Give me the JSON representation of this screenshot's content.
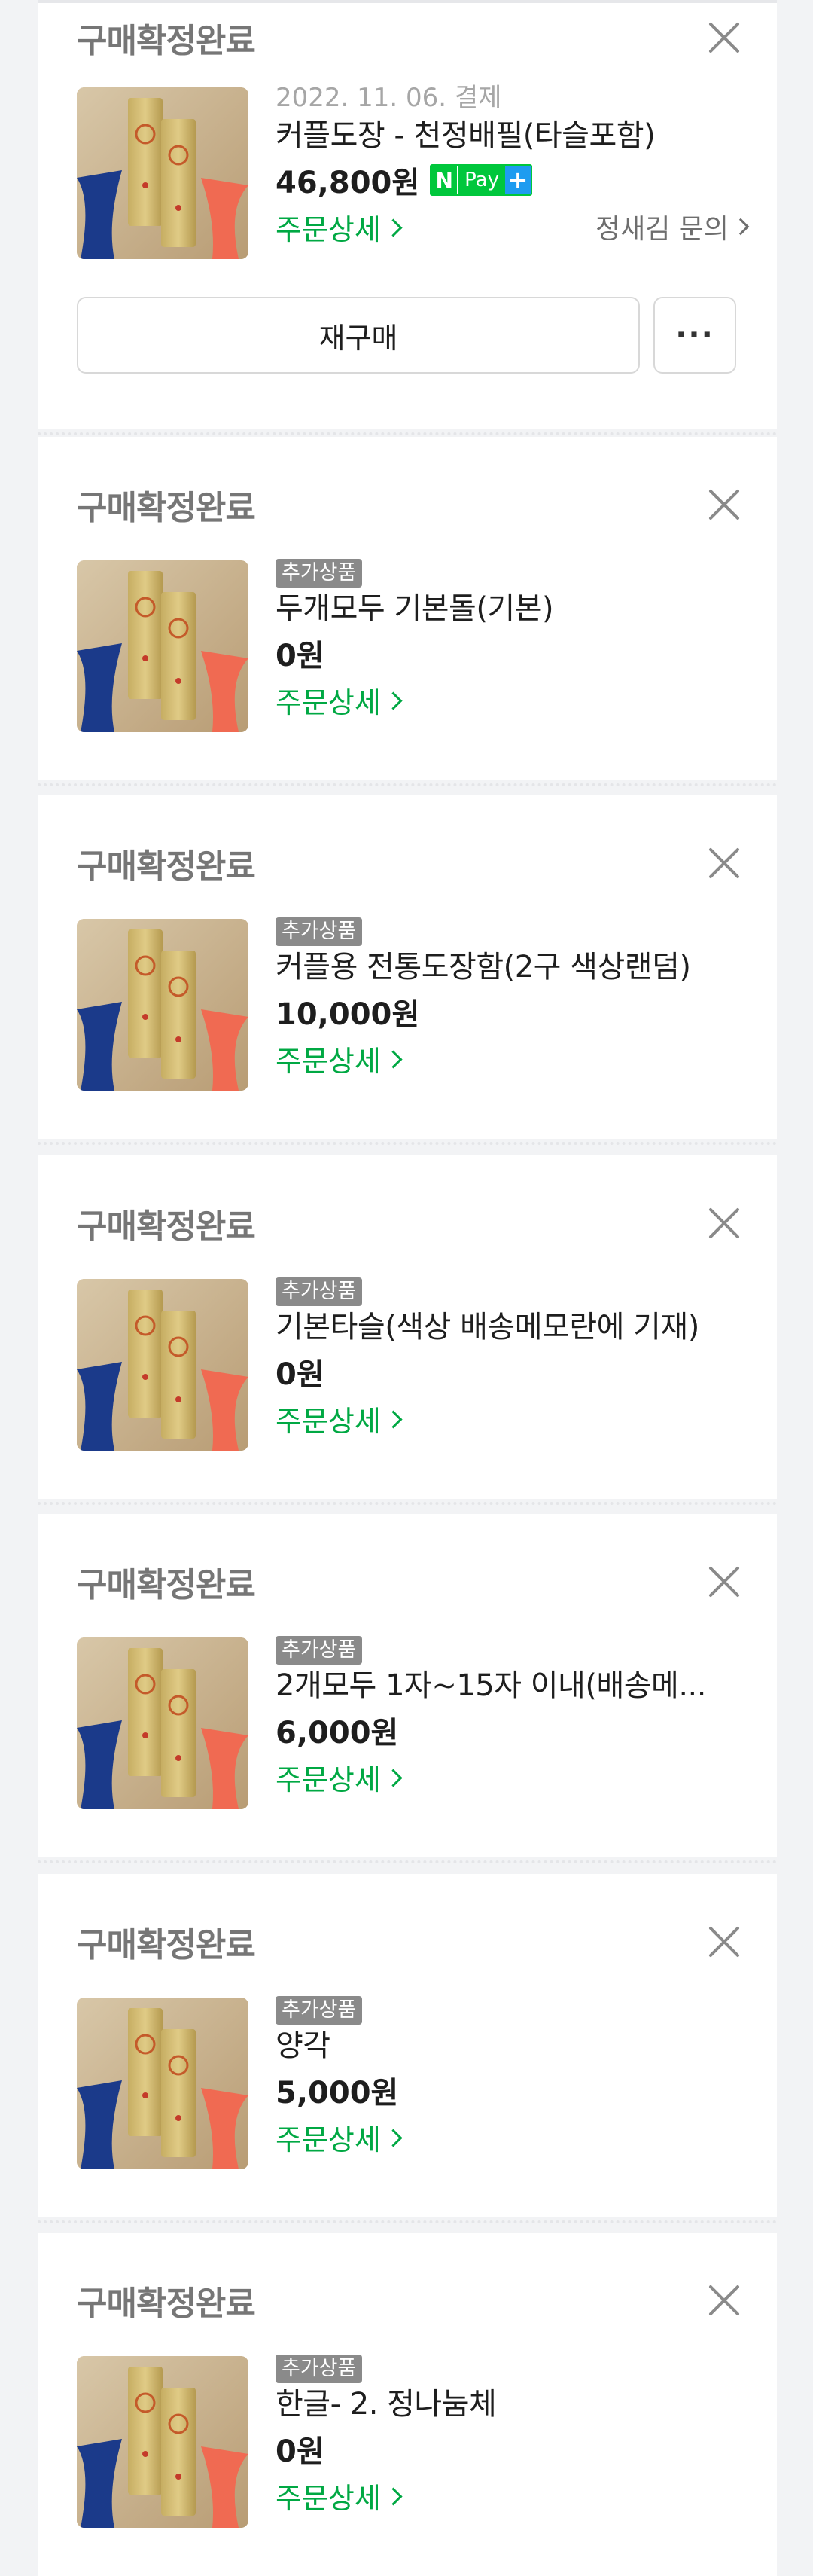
{
  "orders": [
    {
      "status": "구매확정완료",
      "date": "2022. 11. 06. 결제",
      "badge": "",
      "name": "커플도장 - 천정배필(타슬포함)",
      "price": "46,800원",
      "npay": {
        "n": "N",
        "text": "Pay",
        "plus": "+"
      },
      "detail_label": "주문상세",
      "inquiry_label": "정새김 문의",
      "repurchase_label": "재구매",
      "more_label": "···"
    },
    {
      "status": "구매확정완료",
      "badge": "추가상품",
      "name": "두개모두 기본돌(기본)",
      "price": "0원",
      "detail_label": "주문상세"
    },
    {
      "status": "구매확정완료",
      "badge": "추가상품",
      "name": "커플용 전통도장함(2구 색상랜덤)",
      "price": "10,000원",
      "detail_label": "주문상세"
    },
    {
      "status": "구매확정완료",
      "badge": "추가상품",
      "name": "기본타슬(색상 배송메모란에 기재)",
      "price": "0원",
      "detail_label": "주문상세"
    },
    {
      "status": "구매확정완료",
      "badge": "추가상품",
      "name": "2개모두 1자~15자 이내(배송메...",
      "price": "6,000원",
      "detail_label": "주문상세"
    },
    {
      "status": "구매확정완료",
      "badge": "추가상품",
      "name": "양각",
      "price": "5,000원",
      "detail_label": "주문상세"
    },
    {
      "status": "구매확정완료",
      "badge": "추가상품",
      "name": "한글- 2. 정나눔체",
      "price": "0원",
      "detail_label": "주문상세"
    }
  ],
  "colors": {
    "status_text": "#767676",
    "detail_link": "#00a843",
    "npay_green": "#00c73c",
    "npay_blue": "#1e9cf0",
    "badge_bg": "#8a8a8a",
    "page_bg": "#f2f3f5"
  },
  "icons": {
    "close": "close-icon",
    "chevron": "chevron-right-icon",
    "product_image": "couple-seal-product-image"
  }
}
